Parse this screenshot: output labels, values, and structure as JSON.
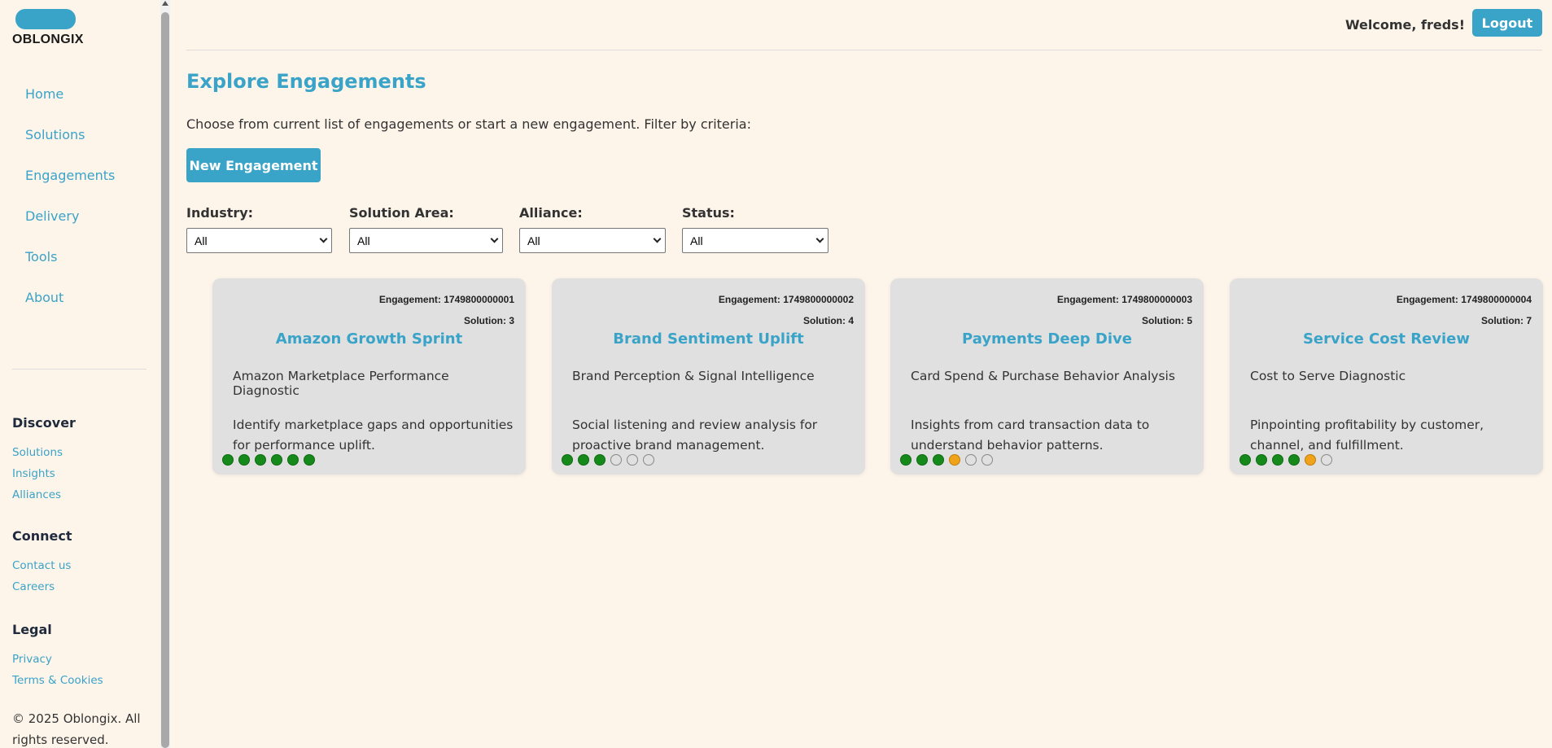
{
  "brand": {
    "name": "OBLONGIX",
    "color": "#3aa3c8"
  },
  "nav": [
    {
      "label": "Home"
    },
    {
      "label": "Solutions"
    },
    {
      "label": "Engagements"
    },
    {
      "label": "Delivery"
    },
    {
      "label": "Tools"
    },
    {
      "label": "About"
    }
  ],
  "footer": {
    "discover": {
      "heading": "Discover",
      "links": [
        "Solutions",
        "Insights",
        "Alliances"
      ]
    },
    "connect": {
      "heading": "Connect",
      "links": [
        "Contact us",
        "Careers"
      ]
    },
    "legal": {
      "heading": "Legal",
      "links": [
        "Privacy",
        "Terms & Cookies"
      ]
    },
    "copyright": "© 2025 Oblongix. All rights reserved."
  },
  "header": {
    "welcome": "Welcome, freds!",
    "logout_label": "Logout"
  },
  "main": {
    "title": "Explore Engagements",
    "intro": "Choose from current list of engagements or start a new engagement. Filter by criteria:",
    "new_button_label": "New Engagement",
    "filters": [
      {
        "label": "Industry:",
        "selected": "All"
      },
      {
        "label": "Solution Area:",
        "selected": "All"
      },
      {
        "label": "Alliance:",
        "selected": "All"
      },
      {
        "label": "Status:",
        "selected": "All"
      }
    ]
  },
  "cards": [
    {
      "engagement": "Engagement: 1749800000001",
      "solution": "Solution: 3",
      "title": "Amazon Growth Sprint",
      "subtitle": "Amazon Marketplace Performance Diagnostic",
      "description": "Identify marketplace gaps and opportunities for performance uplift.",
      "status_dots": [
        "complete",
        "complete",
        "complete",
        "complete",
        "complete",
        "complete"
      ]
    },
    {
      "engagement": "Engagement: 1749800000002",
      "solution": "Solution: 4",
      "title": "Brand Sentiment Uplift",
      "subtitle": "Brand Perception & Signal Intelligence",
      "description": "Social listening and review analysis for proactive brand management.",
      "status_dots": [
        "complete",
        "complete",
        "complete",
        "pending",
        "pending",
        "pending"
      ]
    },
    {
      "engagement": "Engagement: 1749800000003",
      "solution": "Solution: 5",
      "title": "Payments Deep Dive",
      "subtitle": "Card Spend & Purchase Behavior Analysis",
      "description": "Insights from card transaction data to understand behavior patterns.",
      "status_dots": [
        "complete",
        "complete",
        "complete",
        "in-progress",
        "pending",
        "pending"
      ]
    },
    {
      "engagement": "Engagement: 1749800000004",
      "solution": "Solution: 7",
      "title": "Service Cost Review",
      "subtitle": "Cost to Serve Diagnostic",
      "description": "Pinpointing profitability by customer, channel, and fulfillment.",
      "status_dots": [
        "complete",
        "complete",
        "complete",
        "complete",
        "in-progress",
        "pending"
      ]
    }
  ],
  "colors": {
    "background": "#fdf4ea",
    "accent": "#3aa3c8",
    "card": "#e0e0e0",
    "status_complete": "#158a1a",
    "status_in_progress": "#f0a21b"
  }
}
